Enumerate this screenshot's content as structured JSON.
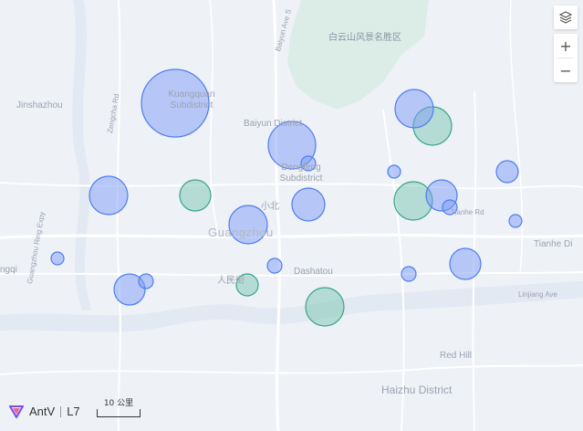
{
  "map": {
    "labels": {
      "baiyun_scenic": "白云山风景名胜区",
      "bayun_ave": "Baiyun Ave S",
      "jinshazhou": "Jinshazhou",
      "zengcha": "Zengcha Rd",
      "kuangquan": "Kuangquan Subdistrict",
      "baiyun_district": "Baiyun District",
      "dengfeng": "Dengfeng Subdistrict",
      "xiaobei": "小北",
      "guangzhou": "Guangzhou",
      "renmin": "人民街",
      "dashatou": "Dashatou",
      "tianhe_rd": "Tianhe Rd",
      "tianhe_dist": "Tianhe Di",
      "ring_expy": "Guangzhou Ring Expy",
      "ngqi": "ngqi",
      "linjiang": "Linjiang Ave",
      "red_hill": "Red Hill",
      "haizhu": "Haizhu District"
    },
    "bubbles": [
      {
        "kind": "blue",
        "r": 37
      },
      {
        "kind": "blue",
        "r": 26
      },
      {
        "kind": "blue",
        "r": 8
      },
      {
        "kind": "blue",
        "r": 21
      },
      {
        "kind": "green",
        "r": 17
      },
      {
        "kind": "blue",
        "r": 8
      },
      {
        "kind": "blue",
        "r": 18
      },
      {
        "kind": "green",
        "r": 21
      },
      {
        "kind": "blue",
        "r": 21
      },
      {
        "kind": "green",
        "r": 21
      },
      {
        "kind": "blue",
        "r": 17
      },
      {
        "kind": "blue",
        "r": 21
      },
      {
        "kind": "blue",
        "r": 12
      },
      {
        "kind": "blue",
        "r": 7
      },
      {
        "kind": "blue",
        "r": 8
      },
      {
        "kind": "blue",
        "r": 7
      },
      {
        "kind": "blue",
        "r": 17
      },
      {
        "kind": "blue",
        "r": 8
      },
      {
        "kind": "blue",
        "r": 17
      },
      {
        "kind": "blue",
        "r": 8
      },
      {
        "kind": "green",
        "r": 12
      },
      {
        "kind": "green",
        "r": 21
      },
      {
        "kind": "blue",
        "r": 7
      }
    ],
    "colors": {
      "blue_fill": "#7e9cf5",
      "blue_stroke": "#4d7ef0",
      "green_fill": "#6cc0aa",
      "green_stroke": "#3aa58a"
    }
  },
  "controls": {
    "layers_icon": "layers-icon",
    "zoom_in": "+",
    "zoom_out": "−"
  },
  "footer": {
    "brand": "AntV",
    "product": "L7",
    "scale_label": "10 公里"
  }
}
